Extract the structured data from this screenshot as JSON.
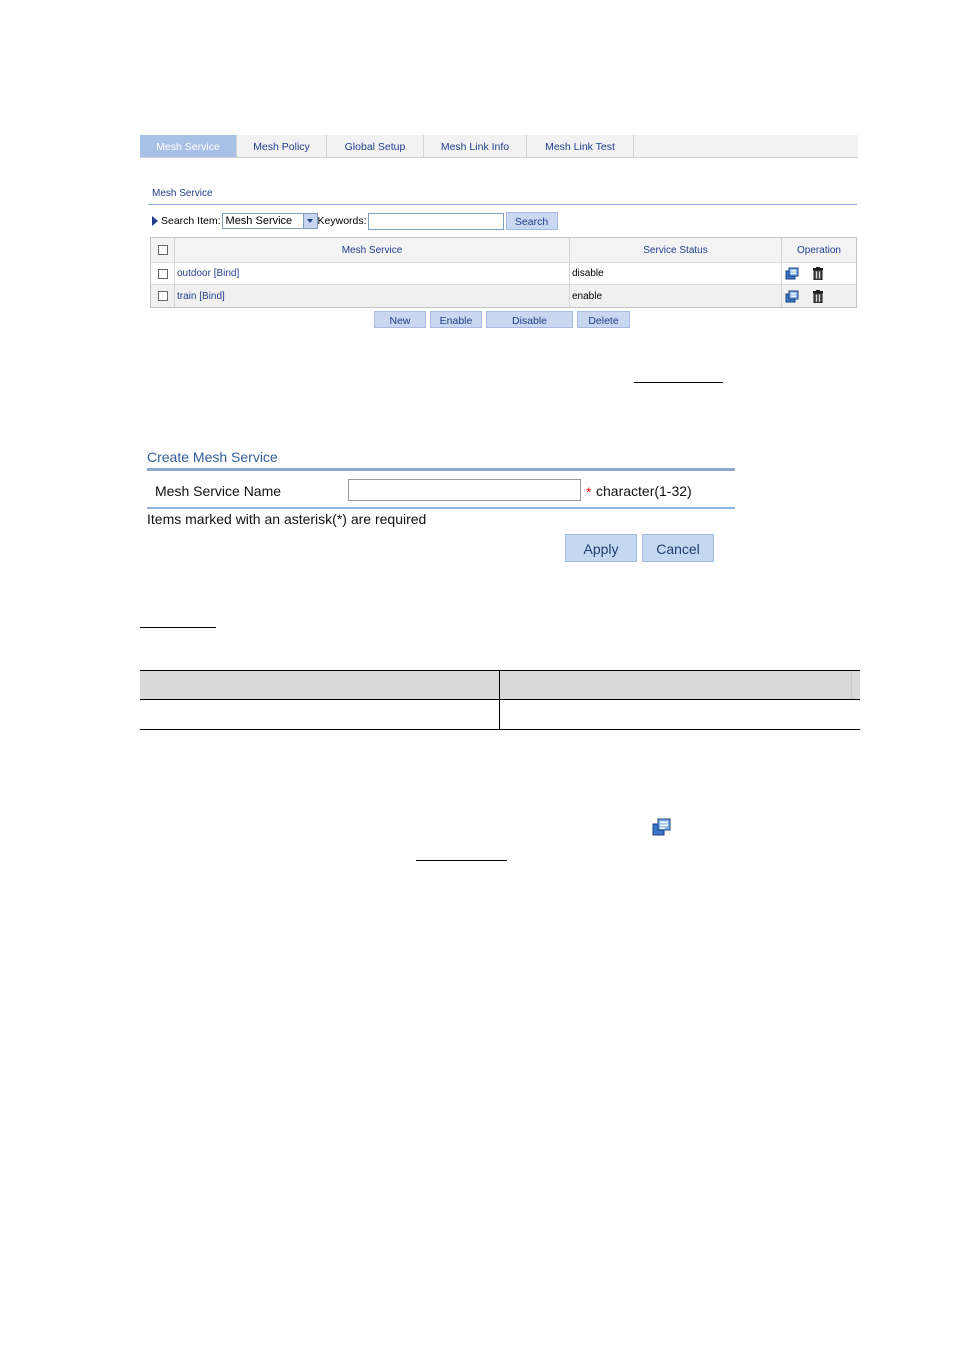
{
  "tabs": [
    {
      "label": "Mesh Service",
      "active": true
    },
    {
      "label": "Mesh Policy",
      "active": false
    },
    {
      "label": "Global Setup",
      "active": false
    },
    {
      "label": "Mesh Link Info",
      "active": false
    },
    {
      "label": "Mesh Link Test",
      "active": false
    }
  ],
  "list_section": {
    "title": "Mesh Service",
    "search": {
      "item_label": "Search Item:",
      "item_selected": "Mesh Service",
      "keywords_label": "Keywords:",
      "keywords_value": "",
      "button": "Search"
    },
    "columns": [
      "Mesh Service",
      "Service Status",
      "Operation"
    ],
    "rows": [
      {
        "name": "outdoor [Bind]",
        "status": "disable"
      },
      {
        "name": "train [Bind]",
        "status": "enable"
      }
    ],
    "buttons": {
      "new": "New",
      "enable": "Enable",
      "disable": "Disable",
      "delete": "Delete"
    }
  },
  "create_form": {
    "title": "Create Mesh Service",
    "field_label": "Mesh Service Name",
    "field_value": "",
    "required_mark": "*",
    "hint": "character(1-32)",
    "note": "Items marked with an asterisk(*) are required",
    "apply": "Apply",
    "cancel": "Cancel"
  },
  "colors": {
    "tab_active": "#a9c0e6",
    "link": "#1f3e8c",
    "button": "#c9d7f0",
    "form_title": "#2f5f99",
    "required": "#dd1111"
  }
}
